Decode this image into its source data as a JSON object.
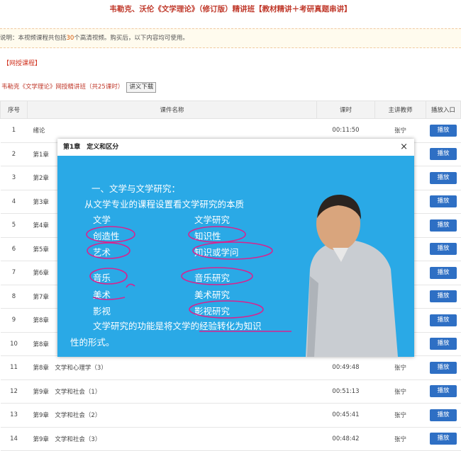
{
  "page": {
    "title": "韦勒克、沃伦《文学理论》（修订版）精讲班【教材精讲＋考研真题串讲】",
    "notice_prefix": "说明：本视频课程共包括",
    "notice_count": "30",
    "notice_suffix": "个高清视频。购买后，以下内容均可使用。",
    "section_label": "【网授课程】",
    "course_title": "韦勒克《文学理论》网授精讲班（共25课时）",
    "download_label": "讲义下载"
  },
  "table": {
    "headers": [
      "序号",
      "课件名称",
      "课时",
      "主讲教师",
      "播放入口"
    ],
    "play_label": "播放",
    "rows": [
      {
        "idx": "1",
        "name": "绪论",
        "time": "00:11:50",
        "teacher": "张宁"
      },
      {
        "idx": "2",
        "name": "第1章",
        "time": "",
        "teacher": ""
      },
      {
        "idx": "3",
        "name": "第2章",
        "time": "",
        "teacher": ""
      },
      {
        "idx": "4",
        "name": "第3章",
        "time": "",
        "teacher": ""
      },
      {
        "idx": "5",
        "name": "第4章",
        "time": "",
        "teacher": ""
      },
      {
        "idx": "6",
        "name": "第5章",
        "time": "",
        "teacher": ""
      },
      {
        "idx": "7",
        "name": "第6章",
        "time": "",
        "teacher": ""
      },
      {
        "idx": "8",
        "name": "第7章",
        "time": "",
        "teacher": ""
      },
      {
        "idx": "9",
        "name": "第8章",
        "time": "",
        "teacher": ""
      },
      {
        "idx": "10",
        "name": "第8章",
        "time": "",
        "teacher": ""
      },
      {
        "idx": "11",
        "name": "第8章　文学和心理学（3）",
        "time": "00:49:48",
        "teacher": "张宁"
      },
      {
        "idx": "12",
        "name": "第9章　文学和社会（1）",
        "time": "00:51:13",
        "teacher": "张宁"
      },
      {
        "idx": "13",
        "name": "第9章　文学和社会（2）",
        "time": "00:45:41",
        "teacher": "张宁"
      },
      {
        "idx": "14",
        "name": "第9章　文学和社会（3）",
        "time": "00:48:42",
        "teacher": "张宁"
      }
    ]
  },
  "modal": {
    "title": "第1章　定义和区分",
    "close": "×",
    "lines": [
      "一、文学与文学研究：",
      "从文学专业的课程设置看文学研究的本质",
      "文学",
      "文学研究",
      "创造性",
      "知识性",
      "艺术",
      "知识或学问",
      "音乐",
      "音乐研究",
      "美术",
      "美术研究",
      "影视",
      "影视研究",
      "文学研究的功能是将文学的经验转化为知识",
      "性的形式。"
    ]
  },
  "colors": {
    "title_red": "#c0392b",
    "play_blue": "#2e6fc4",
    "video_bg": "#2aa9e6",
    "annotation_magenta": "#d8238f"
  }
}
